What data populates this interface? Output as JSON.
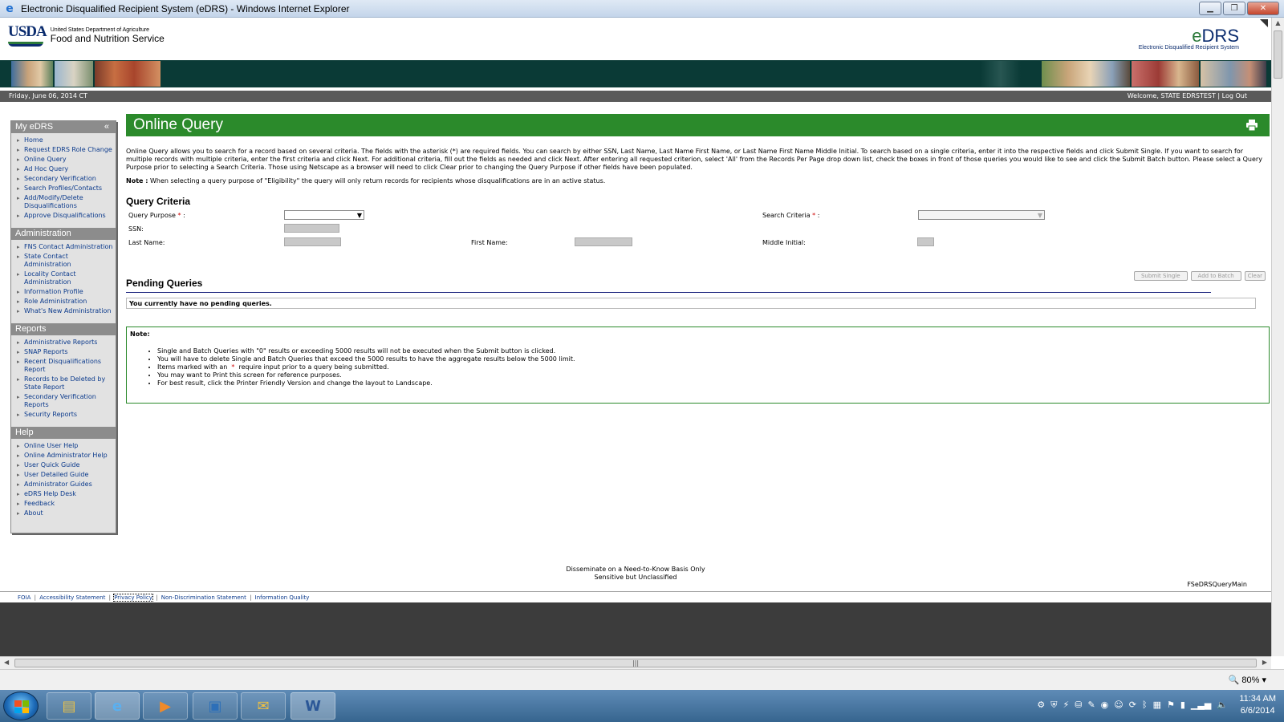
{
  "window": {
    "title": "Electronic Disqualified Recipient System (eDRS) - Windows Internet Explorer",
    "minimize": "▁",
    "maximize": "❐",
    "close": "✕"
  },
  "header": {
    "usda_mark": "USDA",
    "dept_line1": "United States Department of Agriculture",
    "dept_line2": "Food and Nutrition Service",
    "edrs_logo_big_e": "e",
    "edrs_logo_big_rest": "DRS",
    "edrs_logo_small": "Electronic Disqualified Recipient System"
  },
  "info_bar": {
    "date": "Friday, June 06, 2014 CT",
    "welcome": "Welcome, STATE EDRSTEST",
    "separator": "|",
    "logout": "Log Out"
  },
  "sidebar": {
    "my_edrs": {
      "title": "My eDRS",
      "collapse": "«",
      "items": [
        "Home",
        "Request EDRS Role Change",
        "Online Query",
        "Ad Hoc Query",
        "Secondary Verification",
        "Search Profiles/Contacts",
        "Add/Modify/Delete Disqualifications",
        "Approve Disqualifications"
      ]
    },
    "administration": {
      "title": "Administration",
      "items": [
        "FNS Contact Administration",
        "State Contact Administration",
        "Locality Contact Administration",
        "Information Profile",
        "Role Administration",
        "What's New Administration"
      ]
    },
    "reports": {
      "title": "Reports",
      "items": [
        "Administrative Reports",
        "SNAP Reports",
        "Recent Disqualifications Report",
        "Records to be Deleted by State Report",
        "Secondary Verification Reports",
        "Security Reports"
      ]
    },
    "help": {
      "title": "Help",
      "items": [
        "Online User Help",
        "Online Administrator Help",
        "User Quick Guide",
        "User Detailed Guide",
        "Administrator Guides",
        "eDRS Help Desk",
        "Feedback",
        "About"
      ]
    }
  },
  "main": {
    "page_title": "Online Query",
    "intro": "Online Query allows you to search for a record based on several criteria. The fields with the asterisk (*) are required fields. You can search by either SSN, Last Name, Last Name First Name, or Last Name First Name Middle Initial. To search based on a single criteria, enter it into the respective fields and click Submit Single. If you want to search for multiple records with multiple criteria, enter the first criteria and click Next. For additional criteria, fill out the fields as needed and click Next. After entering all requested criterion, select 'All' from the Records Per Page drop down list, check the boxes in front of those queries you would like to see and click the Submit Batch button. Please select a Query Purpose prior to selecting a Search Criteria. Those using Netscape as a browser will need to click Clear prior to changing the Query Purpose if other fields have been populated.",
    "note_label": "Note :",
    "note_text": "When selecting a query purpose of \"Eligibility\" the query will only return records for recipients whose disqualifications are in an active status.",
    "query_criteria_title": "Query Criteria",
    "labels": {
      "query_purpose": "Query Purpose",
      "search_criteria": "Search Criteria",
      "ssn": "SSN:",
      "last_name": "Last Name:",
      "first_name": "First Name:",
      "middle_initial": "Middle Initial:",
      "asterisk": "*",
      "colon": ":"
    },
    "query_purpose_value": "",
    "search_criteria_value": "",
    "buttons": {
      "submit_single": "Submit Single",
      "add_to_batch": "Add to Batch",
      "clear": "Clear"
    },
    "pending_title": "Pending Queries",
    "pending_empty": "You currently have no pending queries.",
    "notes_title": "Note:",
    "notes": [
      "Single and Batch Queries with \"0\" results or exceeding 5000 results will not be executed when the Submit button is clicked.",
      "You will have to delete Single and Batch Queries that exceed the 5000 results to have the aggregate results below the 5000 limit.",
      "require input prior to a query being submitted.",
      "You may want to Print this screen for reference purposes.",
      "For best result, click the Printer Friendly Version and change the layout to Landscape."
    ],
    "notes_item3_prefix": "Items marked with an"
  },
  "footer": {
    "dissem_line1": "Disseminate on a Need-to-Know Basis Only",
    "dissem_line2": "Sensitive but Unclassified",
    "screen_id": "FSeDRSQueryMain",
    "links": [
      "FOIA",
      "Accessibility Statement",
      "Privacy Policy",
      "Non-Discrimination Statement",
      "Information Quality"
    ],
    "link_sep": "|"
  },
  "statusbar": {
    "zoom": "80%"
  },
  "taskbar": {
    "time": "11:34 AM",
    "date": "6/6/2014"
  },
  "colors": {
    "header_green": "#2b8a2b",
    "navy": "#0b2c6e",
    "banner": "#0a3a36",
    "info_bar": "#5a5a5a"
  }
}
